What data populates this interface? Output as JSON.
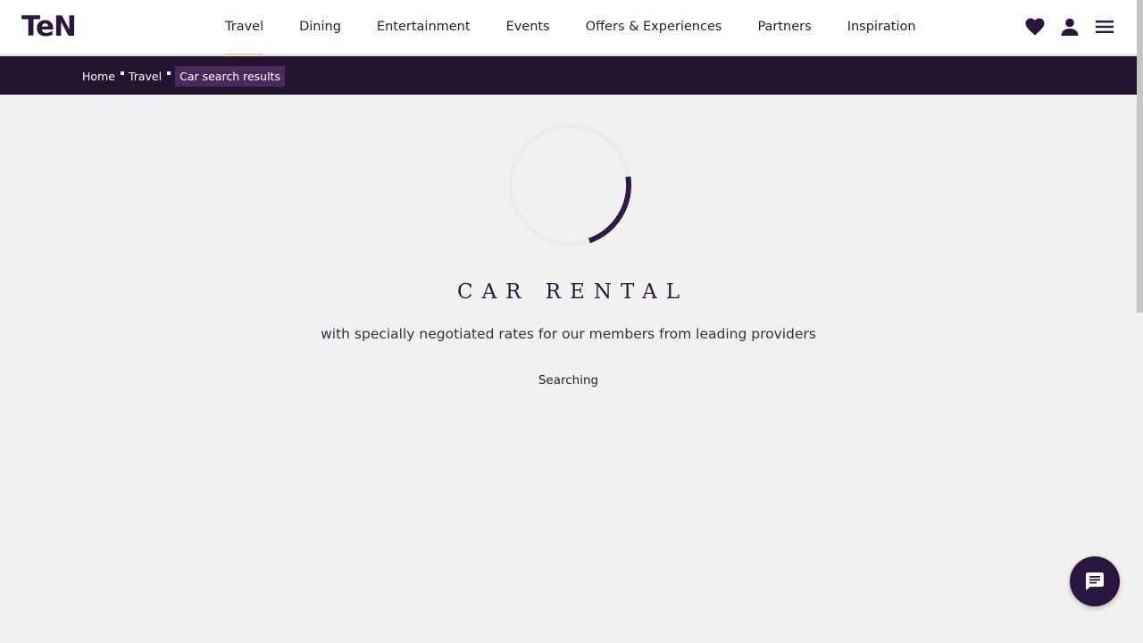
{
  "brand": {
    "logo_text": "TeN",
    "color": "#2b1640"
  },
  "nav": {
    "items": [
      {
        "label": "Travel",
        "active": true
      },
      {
        "label": "Dining"
      },
      {
        "label": "Entertainment"
      },
      {
        "label": "Events"
      },
      {
        "label": "Offers & Experiences"
      },
      {
        "label": "Partners"
      },
      {
        "label": "Inspiration"
      }
    ],
    "icons": [
      "heart-icon",
      "user-icon",
      "hamburger-menu-icon"
    ]
  },
  "breadcrumb": {
    "items": [
      "Home",
      "Travel"
    ],
    "current": "Car search results"
  },
  "main": {
    "title": "CAR RENTAL",
    "subtitle": "with specially negotiated rates for our members from leading providers",
    "status": "Searching"
  },
  "chat": {
    "icon": "chat-icon"
  },
  "colors": {
    "accent": "#2b1640",
    "breadcrumb_bar": "#23152f",
    "active_underline": "#e9c9a0"
  }
}
